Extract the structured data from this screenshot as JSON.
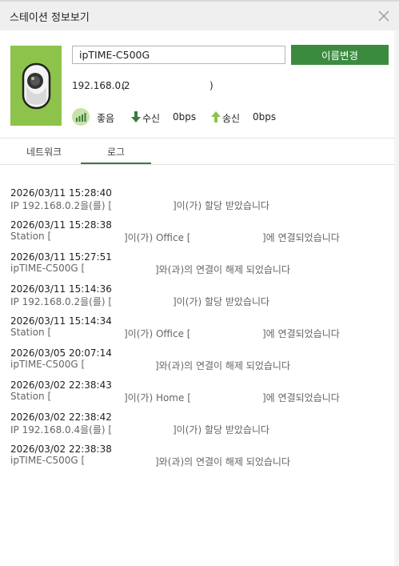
{
  "window": {
    "title": "스테이션 정보보기",
    "close_icon": "close-icon"
  },
  "device": {
    "icon": "camera-icon",
    "tile_color": "#8dc34a",
    "name_value": "ipTIME-C500G",
    "rename_label": "이름변경",
    "ip": "192.168.0.2",
    "ip_paren_open": "(",
    "ip_paren_close": ")"
  },
  "stats": {
    "signal_icon": "signal-strength-icon",
    "signal_label": "좋음",
    "rx_icon": "download-arrow-icon",
    "rx_label": "수신",
    "rx_value": "0bps",
    "tx_icon": "upload-arrow-icon",
    "tx_label": "송신",
    "tx_value": "0bps"
  },
  "tabs": [
    {
      "label": "네트워크",
      "active": false
    },
    {
      "label": "로그",
      "active": true
    }
  ],
  "log": [
    {
      "time": "2026/03/11 15:28:40",
      "msg_a": "IP 192.168.0.2을(를) [",
      "msg_b": "]이(가) 할당 받았습니다"
    },
    {
      "time": "2026/03/11 15:28:38",
      "msg_a": "Station [",
      "msg_b": "]이(가) Office [",
      "msg_c": "]에 연결되었습니다"
    },
    {
      "time": "2026/03/11 15:27:51",
      "msg_a": "ipTIME-C500G [",
      "msg_b": "]와(과)의 연결이 해제 되었습니다"
    },
    {
      "time": "2026/03/11 15:14:36",
      "msg_a": "IP 192.168.0.2을(를) [",
      "msg_b": "]이(가) 할당 받았습니다"
    },
    {
      "time": "2026/03/11 15:14:34",
      "msg_a": "Station [",
      "msg_b": "]이(가) Office [",
      "msg_c": "]에 연결되었습니다"
    },
    {
      "time": "2026/03/05 20:07:14",
      "msg_a": "ipTIME-C500G [",
      "msg_b": "]와(과)의 연결이 해제 되었습니다"
    },
    {
      "time": "2026/03/02 22:38:43",
      "msg_a": "Station [",
      "msg_b": "]이(가) Home [",
      "msg_c": "]에 연결되었습니다"
    },
    {
      "time": "2026/03/02 22:38:42",
      "msg_a": "IP 192.168.0.4을(를) [",
      "msg_b": "]이(가) 할당 받았습니다"
    },
    {
      "time": "2026/03/02 22:38:38",
      "msg_a": "ipTIME-C500G [",
      "msg_b": "]와(과)의 연결이 해제 되었습니다"
    }
  ]
}
